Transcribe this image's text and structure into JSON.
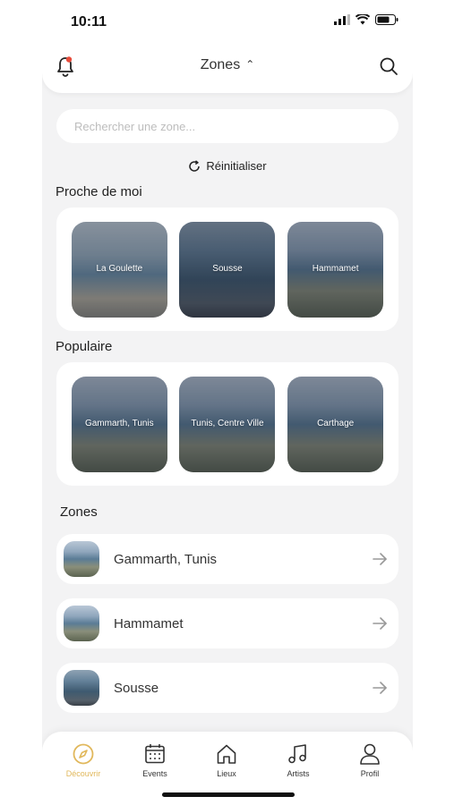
{
  "status_bar": {
    "time": "10:11"
  },
  "header": {
    "title": "Zones",
    "chevron": "chevron-up-icon"
  },
  "search": {
    "placeholder": "Rechercher une zone..."
  },
  "reset": {
    "label": "Réinitialiser"
  },
  "nearby": {
    "title": "Proche de moi",
    "items": [
      {
        "label": "La Goulette"
      },
      {
        "label": "Sousse"
      },
      {
        "label": "Hammamet"
      }
    ]
  },
  "popular": {
    "title": "Populaire",
    "items": [
      {
        "label": "Gammarth, Tunis"
      },
      {
        "label": "Tunis, Centre Ville"
      },
      {
        "label": "Carthage"
      }
    ]
  },
  "zones": {
    "title": "Zones",
    "items": [
      {
        "label": "Gammarth, Tunis"
      },
      {
        "label": "Hammamet"
      },
      {
        "label": "Sousse"
      }
    ]
  },
  "tabs": [
    {
      "label": "Découvrir",
      "icon": "compass-icon",
      "active": true
    },
    {
      "label": "Events",
      "icon": "calendar-icon",
      "active": false
    },
    {
      "label": "Lieux",
      "icon": "home-icon",
      "active": false
    },
    {
      "label": "Artists",
      "icon": "music-icon",
      "active": false
    },
    {
      "label": "Profil",
      "icon": "user-icon",
      "active": false
    }
  ],
  "colors": {
    "accent": "#e1b85c",
    "background": "#f3f3f4",
    "notification_dot": "#e74c3c"
  }
}
